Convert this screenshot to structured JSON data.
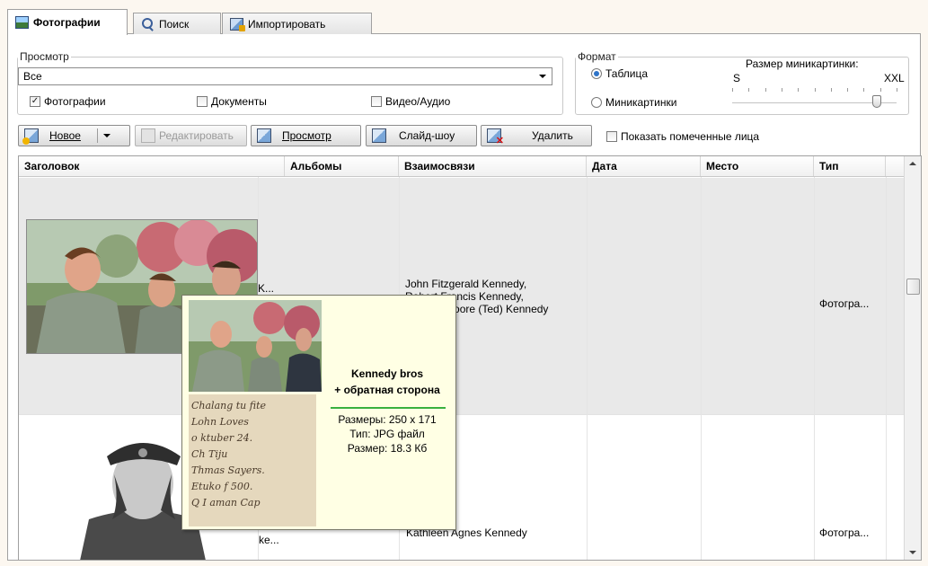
{
  "tabs": [
    {
      "label": "Фотографии",
      "icon": "photo-icon",
      "active": true
    },
    {
      "label": "Поиск",
      "icon": "search-icon",
      "active": false
    },
    {
      "label": "Импортировать",
      "icon": "import-icon",
      "active": false
    }
  ],
  "view": {
    "legend": "Просмотр",
    "filter_value": "Все",
    "checks": [
      {
        "label": "Фотографии",
        "checked": true
      },
      {
        "label": "Документы",
        "checked": false
      },
      {
        "label": "Видео/Аудио",
        "checked": false
      }
    ]
  },
  "format": {
    "legend": "Формат",
    "options": [
      {
        "label": "Таблица",
        "selected": true
      },
      {
        "label": "Миникартинки",
        "selected": false
      }
    ],
    "size_label": "Размер миникартинки:",
    "size_min": "S",
    "size_max": "XXL",
    "size_level": 0.88
  },
  "toolbar": {
    "new_label": "Новое",
    "edit_label": "Редактировать",
    "view_label": "Просмотр",
    "slideshow_label": "Слайд-шоу",
    "delete_label": "Удалить",
    "show_faces_label": "Показать помеченные лица",
    "show_faces_checked": false
  },
  "table": {
    "columns": [
      "Заголовок",
      "Альбомы",
      "Взаимосвязи",
      "Дата",
      "Место",
      "Тип"
    ],
    "rows": [
      {
        "title_fragment": "K...",
        "relations_line1": "John Fitzgerald Kennedy,",
        "relations_line2": "Robert Francis Kennedy,",
        "relations_line3": "Edward Moore (Ted) Kennedy",
        "type": "Фотогра..."
      },
      {
        "title_fragment": "ke...",
        "relations_line1": "Kathleen Agnes Kennedy",
        "type": "Фотогра..."
      }
    ]
  },
  "tooltip": {
    "title": "Kennedy bros",
    "subtitle": "+ обратная сторона",
    "dimensions": "Размеры: 250 x 171",
    "filetype": "Тип: JPG файл",
    "filesize": "Размер: 18.3 Кб",
    "handwriting_lines": [
      "Chalang tu fite",
      "Lohn Loves",
      "o ktuber 24.",
      "Ch Tiju",
      "Thmas Sayers.",
      "Etuko f 500.",
      "Q I aman Cap"
    ]
  },
  "colors": {
    "background": "#fcf7f0",
    "tooltip_bg": "#ffffe4",
    "tooltip_rule": "#38b040",
    "selected_row": "#e9e9e9"
  }
}
